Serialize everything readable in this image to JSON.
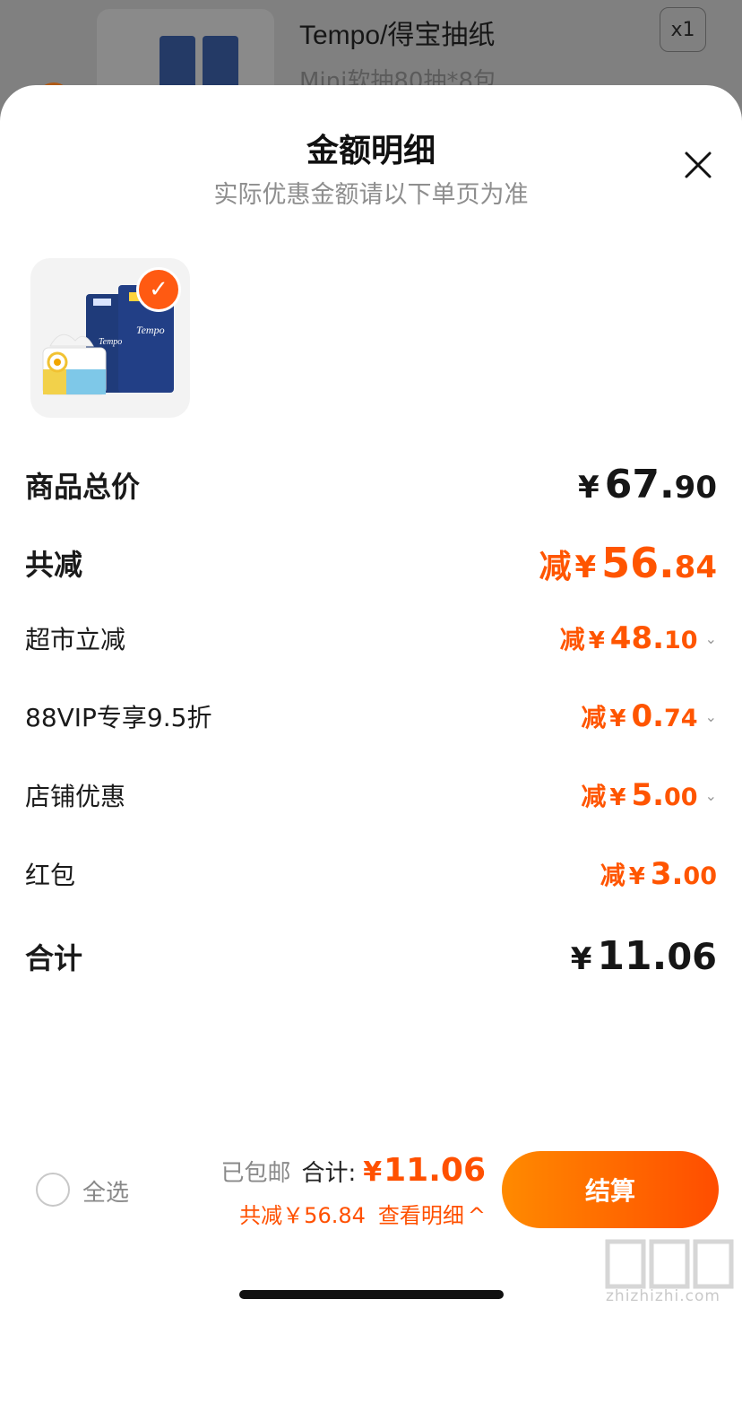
{
  "background_item": {
    "title": "Tempo/得宝抽纸",
    "variant": "Mini软抽80抽*8包",
    "quantity": "x1"
  },
  "sheet": {
    "title": "金额明细",
    "subtitle": "实际优惠金额请以下单页为准"
  },
  "breakdown": {
    "total_price": {
      "label": "商品总价",
      "yen": "¥",
      "int": "67.",
      "dec": "90"
    },
    "total_discount": {
      "label": "共减",
      "prefix": "减",
      "yen": "¥",
      "int": "56.",
      "dec": "84"
    },
    "items": [
      {
        "label": "超市立减",
        "prefix": "减",
        "yen": "¥",
        "int": "48.",
        "dec": "10",
        "expandable": true
      },
      {
        "label": "88VIP专享9.5折",
        "prefix": "减",
        "yen": "¥",
        "int": "0.",
        "dec": "74",
        "expandable": true
      },
      {
        "label": "店铺优惠",
        "prefix": "减",
        "yen": "¥",
        "int": "5.",
        "dec": "00",
        "expandable": true
      },
      {
        "label": "红包",
        "prefix": "减",
        "yen": "¥",
        "int": "3.",
        "dec": "00",
        "expandable": false
      }
    ],
    "grand_total": {
      "label": "合计",
      "yen": "¥",
      "int": "11.",
      "dec": "06"
    }
  },
  "bottom_bar": {
    "select_all": "全选",
    "free_shipping": "已包邮",
    "total_label": "合计:",
    "total_yen": "¥",
    "total_value": "11.06",
    "discount_text": "共减￥56.84",
    "details_link": "查看明细",
    "details_chevron": "^",
    "checkout": "结算"
  },
  "watermark": {
    "text": "zhizhizhi.com"
  },
  "colors": {
    "accent": "#ff5500",
    "button_start": "#ff8a00",
    "button_end": "#ff4d00"
  }
}
